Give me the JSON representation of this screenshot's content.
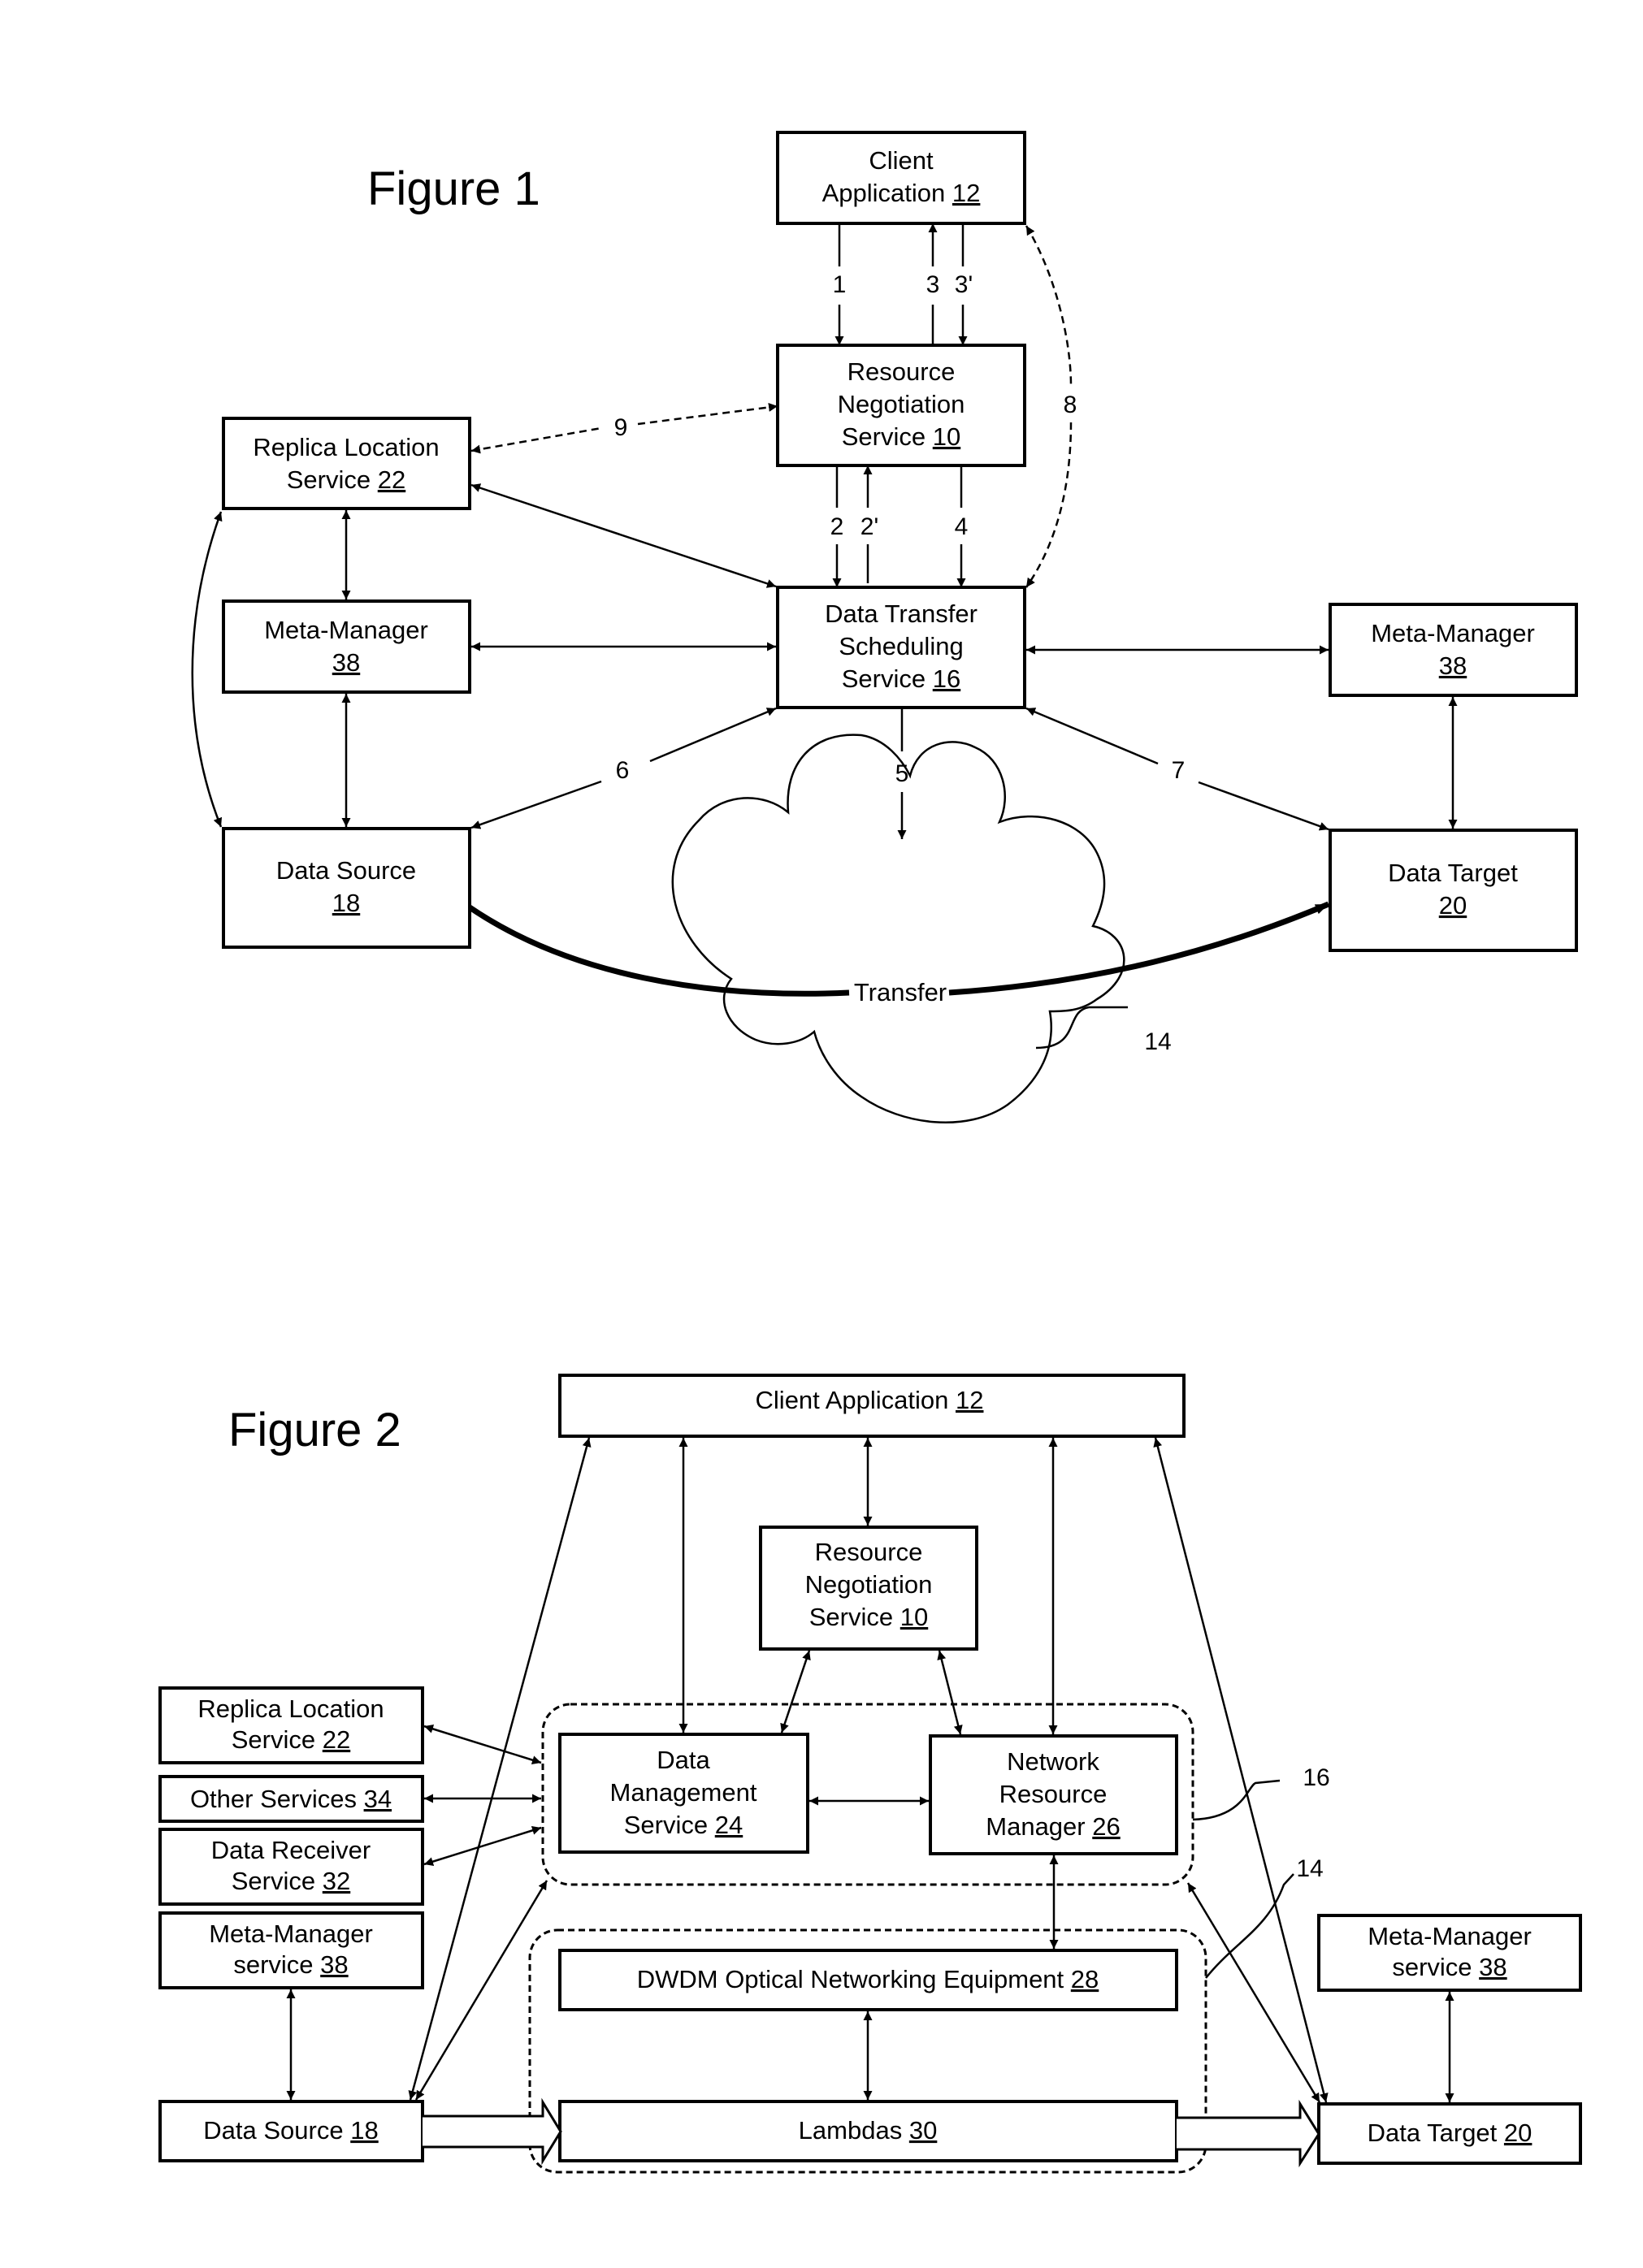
{
  "figure1": {
    "title": "Figure 1",
    "boxes": {
      "client_app": {
        "lines": [
          "Client",
          "Application"
        ],
        "ref": "12"
      },
      "resource_negotiation": {
        "lines": [
          "Resource",
          "Negotiation",
          "Service"
        ],
        "ref": "10"
      },
      "replica_location": {
        "lines": [
          "Replica Location",
          "Service"
        ],
        "ref": "22"
      },
      "meta_manager_left": {
        "lines": [
          "Meta-Manager"
        ],
        "ref": "38"
      },
      "data_transfer_scheduling": {
        "lines": [
          "Data Transfer",
          "Scheduling",
          "Service"
        ],
        "ref": "16"
      },
      "meta_manager_right": {
        "lines": [
          "Meta-Manager"
        ],
        "ref": "38"
      },
      "data_source": {
        "lines": [
          "Data Source"
        ],
        "ref": "18"
      },
      "data_target": {
        "lines": [
          "Data Target"
        ],
        "ref": "20"
      }
    },
    "edge_labels": {
      "e1": "1",
      "e3": "3",
      "e3p": "3'",
      "e2": "2",
      "e2p": "2'",
      "e4": "4",
      "e5": "5",
      "e6": "6",
      "e7": "7",
      "e8": "8",
      "e9": "9"
    },
    "transfer_label": "Transfer",
    "network_ref": "14"
  },
  "figure2": {
    "title": "Figure 2",
    "boxes": {
      "client_app": {
        "lines": [
          "Client Application"
        ],
        "ref": "12"
      },
      "resource_negotiation": {
        "lines": [
          "Resource",
          "Negotiation",
          "Service"
        ],
        "ref": "10"
      },
      "replica_location": {
        "lines": [
          "Replica Location",
          "Service"
        ],
        "ref": "22"
      },
      "other_services": {
        "lines": [
          "Other Services"
        ],
        "ref": "34"
      },
      "data_receiver": {
        "lines": [
          "Data Receiver",
          "Service"
        ],
        "ref": "32"
      },
      "meta_manager_left": {
        "lines": [
          "Meta-Manager",
          "service"
        ],
        "ref": "38"
      },
      "data_management": {
        "lines": [
          "Data",
          "Management",
          "Service"
        ],
        "ref": "24"
      },
      "network_resource_manager": {
        "lines": [
          "Network",
          "Resource",
          "Manager"
        ],
        "ref": "26"
      },
      "dwdm": {
        "lines": [
          "DWDM Optical Networking Equipment"
        ],
        "ref": "28"
      },
      "lambdas": {
        "lines": [
          "Lambdas"
        ],
        "ref": "30"
      },
      "data_source": {
        "lines": [
          "Data Source"
        ],
        "ref": "18"
      },
      "data_target": {
        "lines": [
          "Data Target"
        ],
        "ref": "20"
      },
      "meta_manager_right": {
        "lines": [
          "Meta-Manager",
          "service"
        ],
        "ref": "38"
      }
    },
    "group_refs": {
      "scheduling_group": "16",
      "network_group": "14"
    }
  }
}
